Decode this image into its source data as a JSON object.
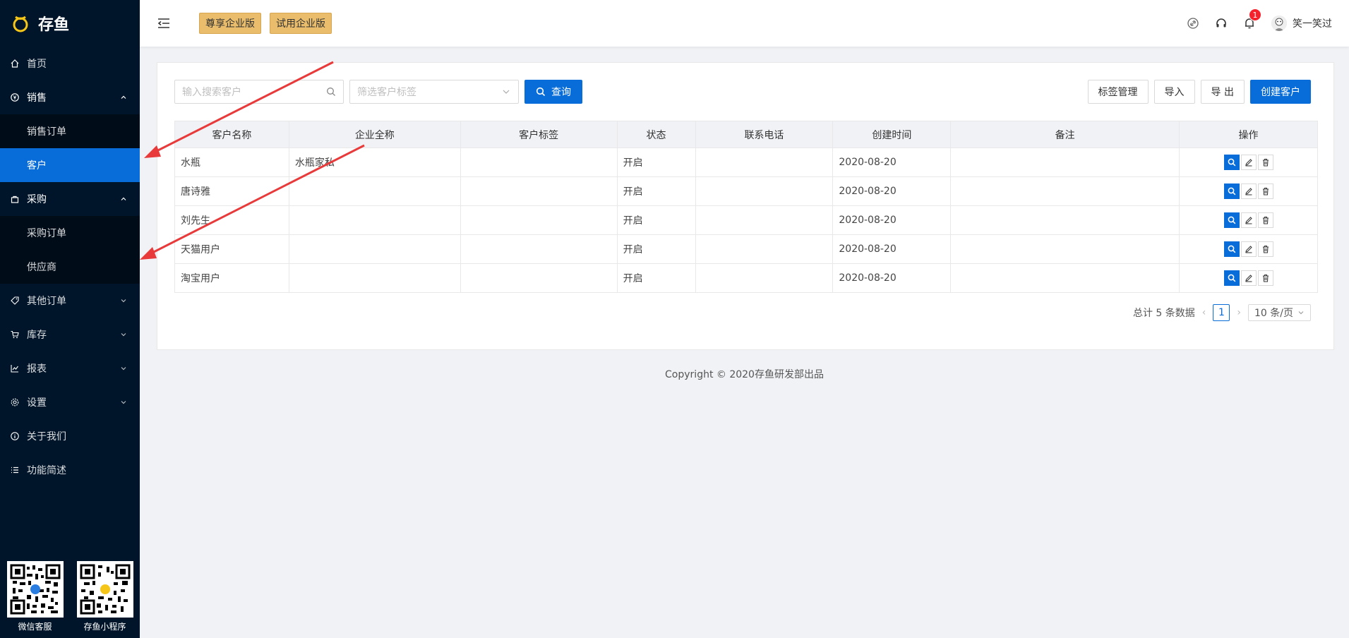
{
  "brand": {
    "name": "存鱼"
  },
  "sidebar": {
    "items": [
      {
        "label": "首页",
        "icon": "home-icon"
      },
      {
        "label": "销售",
        "icon": "yen-circle-icon",
        "expanded": true,
        "children": [
          {
            "label": "销售订单"
          },
          {
            "label": "客户",
            "active": true
          }
        ]
      },
      {
        "label": "采购",
        "icon": "bag-icon",
        "expanded": true,
        "children": [
          {
            "label": "采购订单"
          },
          {
            "label": "供应商"
          }
        ]
      },
      {
        "label": "其他订单",
        "icon": "tag-icon"
      },
      {
        "label": "库存",
        "icon": "cart-icon"
      },
      {
        "label": "报表",
        "icon": "line-chart-icon"
      },
      {
        "label": "设置",
        "icon": "gear-icon"
      },
      {
        "label": "关于我们",
        "icon": "info-circle-icon"
      },
      {
        "label": "功能简述",
        "icon": "list-icon"
      }
    ],
    "qr": [
      {
        "label": "微信客服"
      },
      {
        "label": "存鱼小程序"
      }
    ]
  },
  "topbar": {
    "edition_buttons": [
      "尊享企业版",
      "试用企业版"
    ],
    "notification_count": "1",
    "username": "笑一笑过"
  },
  "toolbar": {
    "search_placeholder": "输入搜索客户",
    "tag_filter_placeholder": "筛选客户标签",
    "query_label": "查询",
    "tag_manage_label": "标签管理",
    "import_label": "导入",
    "export_label": "导 出",
    "create_label": "创建客户"
  },
  "table": {
    "columns": [
      "客户名称",
      "企业全称",
      "客户标签",
      "状态",
      "联系电话",
      "创建时间",
      "备注",
      "操作"
    ],
    "rows": [
      [
        "水瓶",
        "水瓶家私",
        "",
        "开启",
        "",
        "2020-08-20",
        ""
      ],
      [
        "唐诗雅",
        "",
        "",
        "开启",
        "",
        "2020-08-20",
        ""
      ],
      [
        "刘先生",
        "",
        "",
        "开启",
        "",
        "2020-08-20",
        ""
      ],
      [
        "天猫用户",
        "",
        "",
        "开启",
        "",
        "2020-08-20",
        ""
      ],
      [
        "淘宝用户",
        "",
        "",
        "开启",
        "",
        "2020-08-20",
        ""
      ]
    ]
  },
  "pagination": {
    "total_text": "总计 5 条数据",
    "current_page": "1",
    "page_size": "10 条/页"
  },
  "footer": {
    "text": "Copyright © 2020存鱼研发部出品"
  },
  "colors": {
    "sidebar": "#001529",
    "primary": "#096dd9",
    "edition": "#e9bd6b",
    "arrow": "#e83a3a"
  }
}
